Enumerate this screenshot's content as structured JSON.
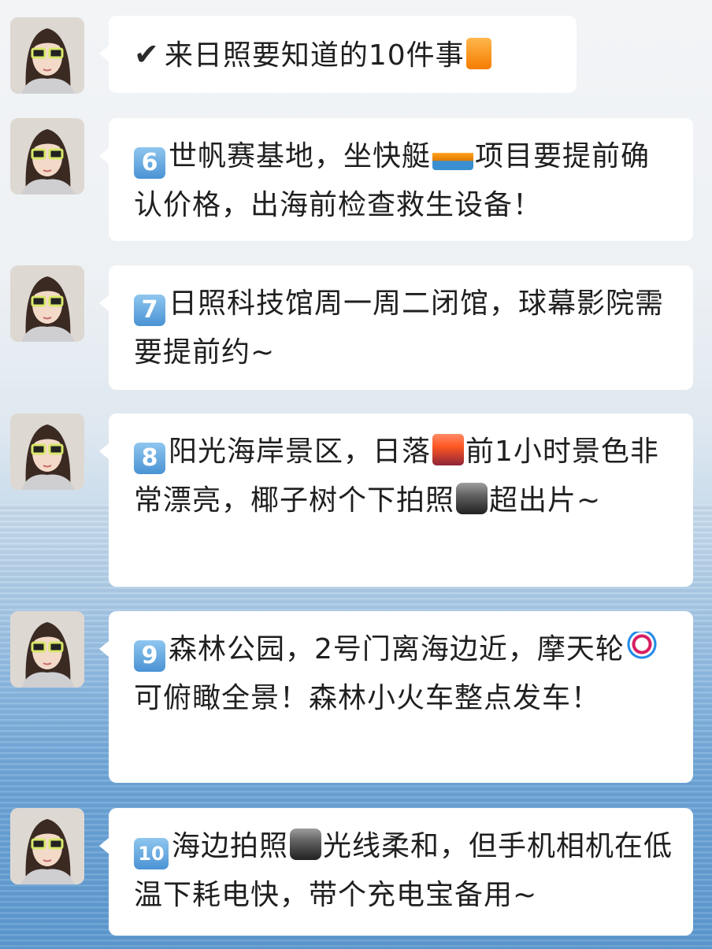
{
  "title_bubble": {
    "check_icon": "heavy-check-mark-icon",
    "text": "来日照要知道的10件事",
    "emoji": "orange-book-icon"
  },
  "messages": [
    {
      "badge": "6",
      "parts": [
        "世帆赛基地，坐快艇",
        "项目要提前确认价格，出海前检查救生设备！"
      ],
      "emoji": [
        "speedboat-icon"
      ]
    },
    {
      "badge": "7",
      "parts": [
        "日照科技馆周一周二闭馆，球幕影院需要提前约~"
      ],
      "emoji": []
    },
    {
      "badge": "8",
      "parts": [
        "阳光海岸景区，日落",
        "前1小时景色非常漂亮，椰子树个下拍照",
        "超出片~"
      ],
      "emoji": [
        "city-sunset-icon",
        "camera-flash-icon"
      ]
    },
    {
      "badge": "9",
      "parts": [
        "森林公园，2号门离海边近，摩天轮",
        "可俯瞰全景！森林小火车整点发车！"
      ],
      "emoji": [
        "ferris-wheel-icon"
      ]
    },
    {
      "badge": "10",
      "parts": [
        "海边拍照",
        "光线柔和，但手机相机在低温下耗电快，带个充电宝备用~"
      ],
      "emoji": [
        "camera-flash-icon"
      ]
    }
  ],
  "colors": {
    "bubble": "#ffffff",
    "badge": "#4a93d4",
    "text": "#1f1f1f"
  }
}
